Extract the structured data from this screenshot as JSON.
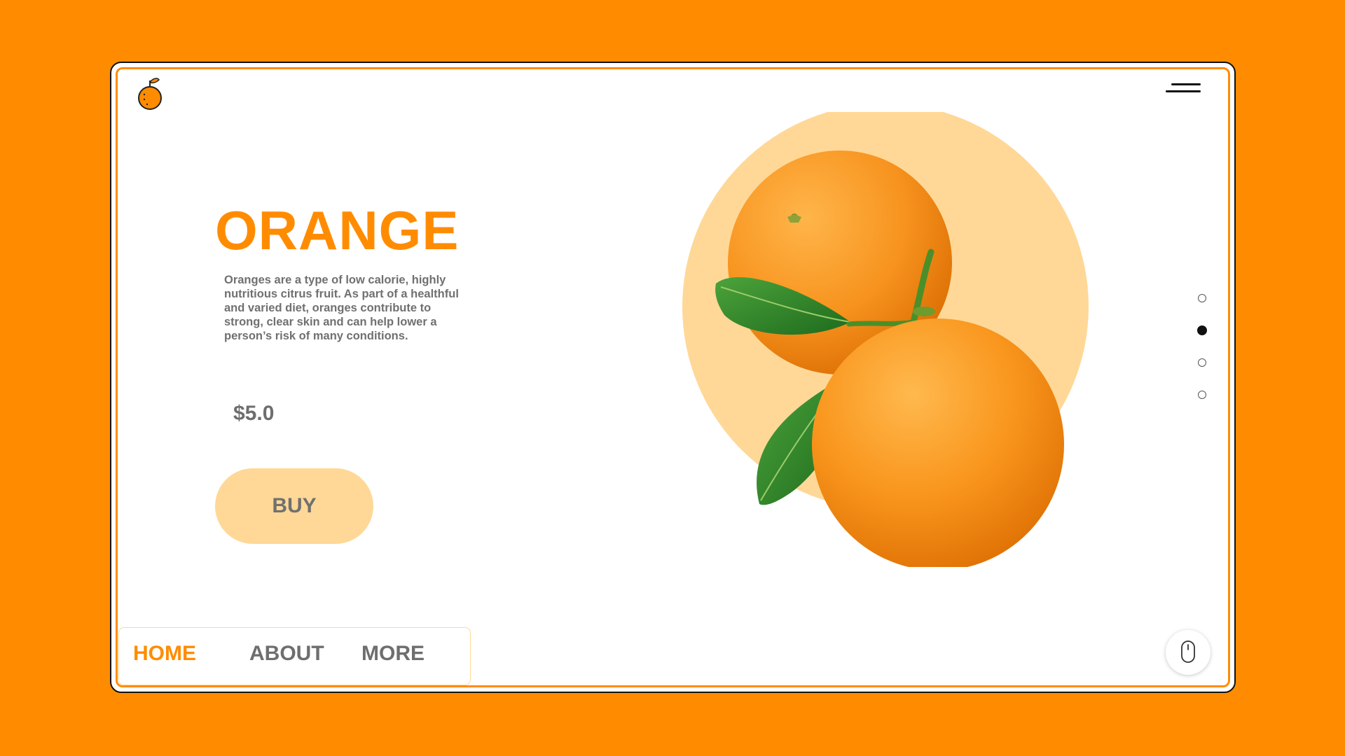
{
  "header": {
    "logo_icon": "orange-fruit-icon",
    "menu_icon": "hamburger-menu-icon"
  },
  "product": {
    "title": "ORANGE",
    "description": "Oranges are a type of low calorie, highly nutritious citrus fruit. As part of a healthful and varied diet, oranges contribute to strong, clear skin and can help lower a person’s risk of many conditions.",
    "price": "$5.0",
    "buy_label": "BUY"
  },
  "nav": {
    "items": [
      {
        "label": "HOME",
        "active": true
      },
      {
        "label": "ABOUT",
        "active": false
      },
      {
        "label": "MORE",
        "active": false
      }
    ]
  },
  "slider": {
    "count": 4,
    "active_index": 1
  },
  "scroll_hint": {
    "icon": "mouse-scroll-icon"
  },
  "colors": {
    "brand": "#FF8C00",
    "accent_light": "#FFD897",
    "text_gray": "#707070",
    "dark": "#111111"
  }
}
